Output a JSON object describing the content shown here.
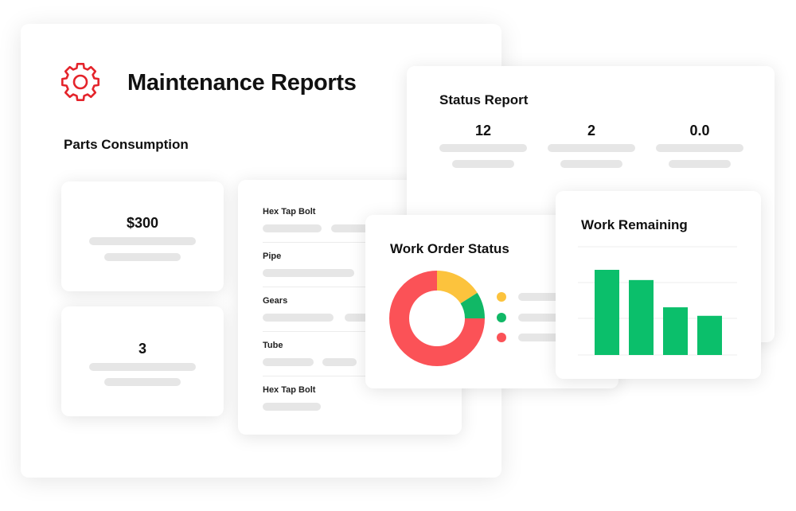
{
  "header": {
    "title": "Maintenance Reports",
    "icon": "gear-icon"
  },
  "parts_consumption": {
    "title": "Parts Consumption",
    "cost": "$300",
    "count": "3",
    "parts": [
      {
        "name": "Hex Tap Bolt"
      },
      {
        "name": "Pipe"
      },
      {
        "name": "Gears"
      },
      {
        "name": "Tube"
      },
      {
        "name": "Hex Tap Bolt"
      }
    ]
  },
  "status_report": {
    "title": "Status Report",
    "stats": [
      {
        "value": "12"
      },
      {
        "value": "2"
      },
      {
        "value": "0.0"
      }
    ]
  },
  "work_order_status": {
    "title": "Work Order Status",
    "colors": {
      "red": "#fb5257",
      "yellow": "#fcc33d",
      "green": "#11b866"
    }
  },
  "work_remaining": {
    "title": "Work Remaining",
    "bar_color": "#0bbf6b"
  },
  "colors": {
    "accent": "#e4242b",
    "placeholder": "#e6e6e6"
  },
  "chart_data": [
    {
      "type": "pie",
      "title": "Work Order Status",
      "slices": [
        {
          "color": "#fcc33d",
          "value": 16
        },
        {
          "color": "#11b866",
          "value": 9
        },
        {
          "color": "#fb5257",
          "value": 75
        }
      ]
    },
    {
      "type": "bar",
      "title": "Work Remaining",
      "values": [
        100,
        88,
        56,
        46
      ],
      "ylim": [
        0,
        100
      ],
      "grid": true
    }
  ]
}
